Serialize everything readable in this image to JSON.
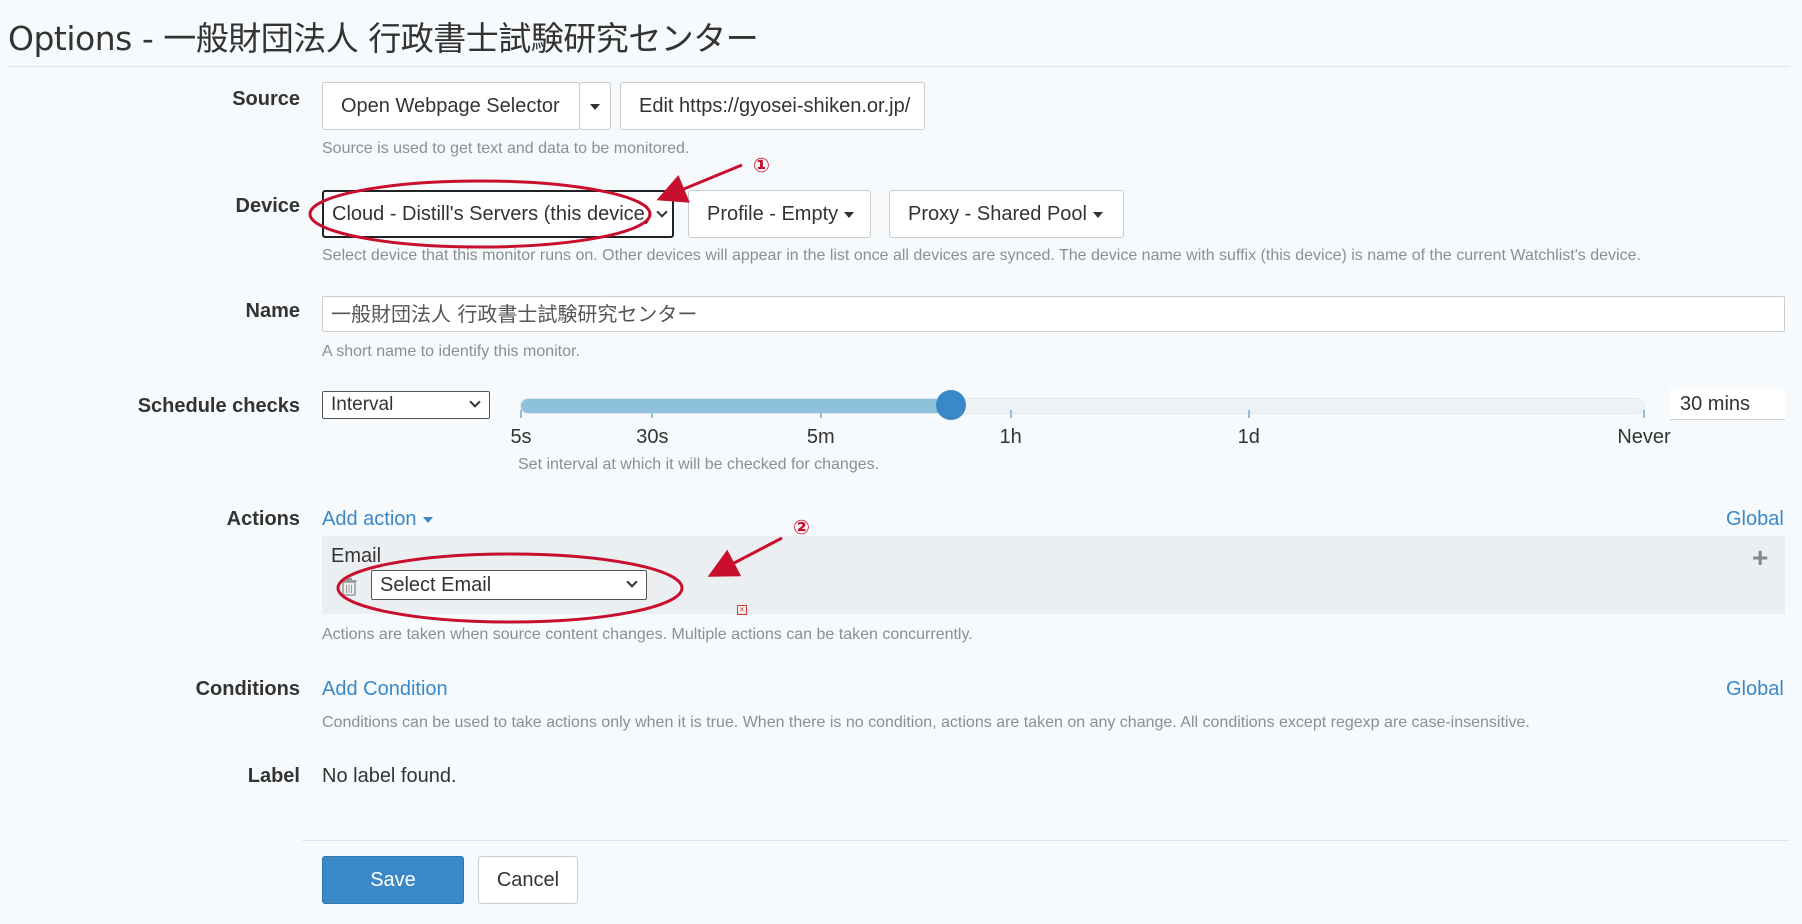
{
  "window": {
    "title": "Options - 一般財団法人 行政書士試験研究センター"
  },
  "source": {
    "label": "Source",
    "open_selector": "Open Webpage Selector",
    "edit_url": "Edit https://gyosei-shiken.or.jp/",
    "help": "Source is used to get text and data to be monitored."
  },
  "device": {
    "label": "Device",
    "selected": "Cloud - Distill's Servers (this device)",
    "profile": "Profile - Empty",
    "proxy": "Proxy - Shared Pool",
    "help": "Select device that this monitor runs on. Other devices will appear in the list once all devices are synced. The device name with suffix (this device) is name of the current Watchlist's device."
  },
  "name": {
    "label": "Name",
    "value": "一般財団法人 行政書士試験研究センター",
    "help": "A short name to identify this monitor."
  },
  "schedule": {
    "label": "Schedule checks",
    "mode": "Interval",
    "value_text": "30 mins",
    "slider_fraction": 0.383,
    "ticks": [
      "5s",
      "30s",
      "5m",
      "1h",
      "1d",
      "Never"
    ],
    "help": "Set interval at which it will be checked for changes."
  },
  "actions": {
    "label": "Actions",
    "add": "Add action",
    "global": "Global",
    "email_label": "Email",
    "email_select": "Select Email",
    "help": "Actions are taken when source content changes. Multiple actions can be taken concurrently."
  },
  "conditions": {
    "label": "Conditions",
    "add": "Add Condition",
    "global": "Global",
    "help": "Conditions can be used to take actions only when it is true. When there is no condition, actions are taken on any change. All conditions except regexp are case-insensitive."
  },
  "label_field": {
    "label": "Label",
    "value": "No label found."
  },
  "footer": {
    "save": "Save",
    "cancel": "Cancel"
  },
  "annotations": {
    "one": "①",
    "two": "②",
    "color": "#c8102e"
  },
  "colors": {
    "accent": "#3a88c8",
    "slider_fill": "#8ec2dc",
    "background": "#f6fafc"
  }
}
